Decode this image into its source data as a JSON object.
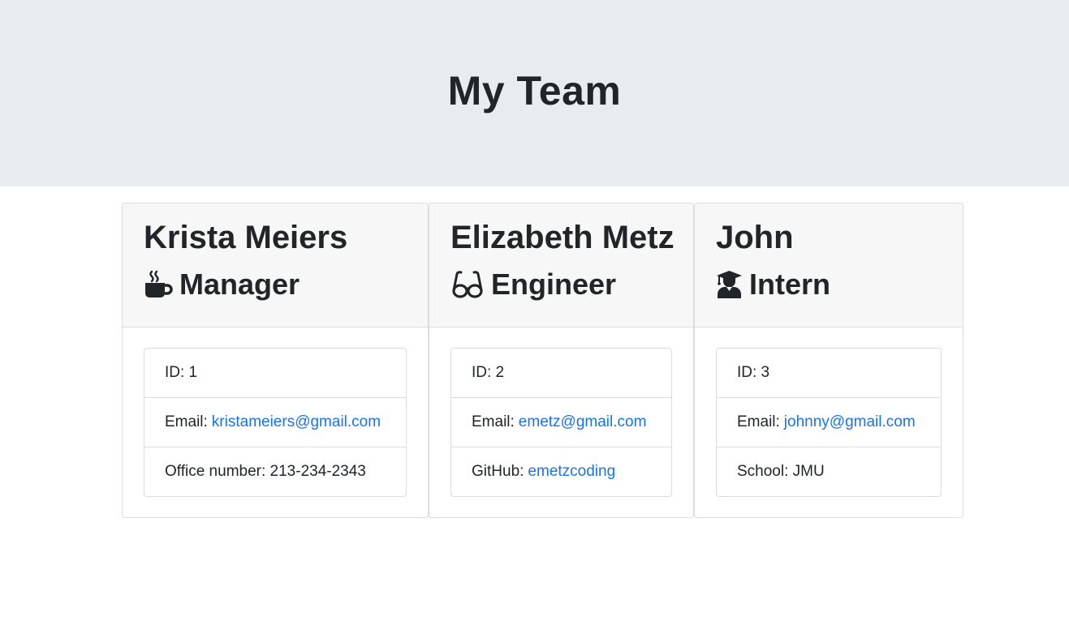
{
  "header": {
    "title": "My Team"
  },
  "team": [
    {
      "name": "Krista Meiers",
      "role": "Manager",
      "role_icon": "coffee-icon",
      "id_label": "ID: 1",
      "email_prefix": "Email:",
      "email": "kristameiers@gmail.com",
      "extra_label": "Office number: 213-234-2343"
    },
    {
      "name": "Elizabeth Metz",
      "role": "Engineer",
      "role_icon": "glasses-icon",
      "id_label": "ID: 2",
      "email_prefix": "Email:",
      "email": "emetz@gmail.com",
      "extra_prefix": "GitHub:",
      "extra_link": "emetzcoding"
    },
    {
      "name": "John",
      "role": "Intern",
      "role_icon": "graduate-icon",
      "id_label": "ID: 3",
      "email_prefix": "Email:",
      "email": "johnny@gmail.com",
      "extra_label": "School: JMU"
    }
  ],
  "colors": {
    "link": "#1a73e8",
    "jumbotron_bg": "#e9ecef",
    "card_header_bg": "#f7f7f7"
  }
}
